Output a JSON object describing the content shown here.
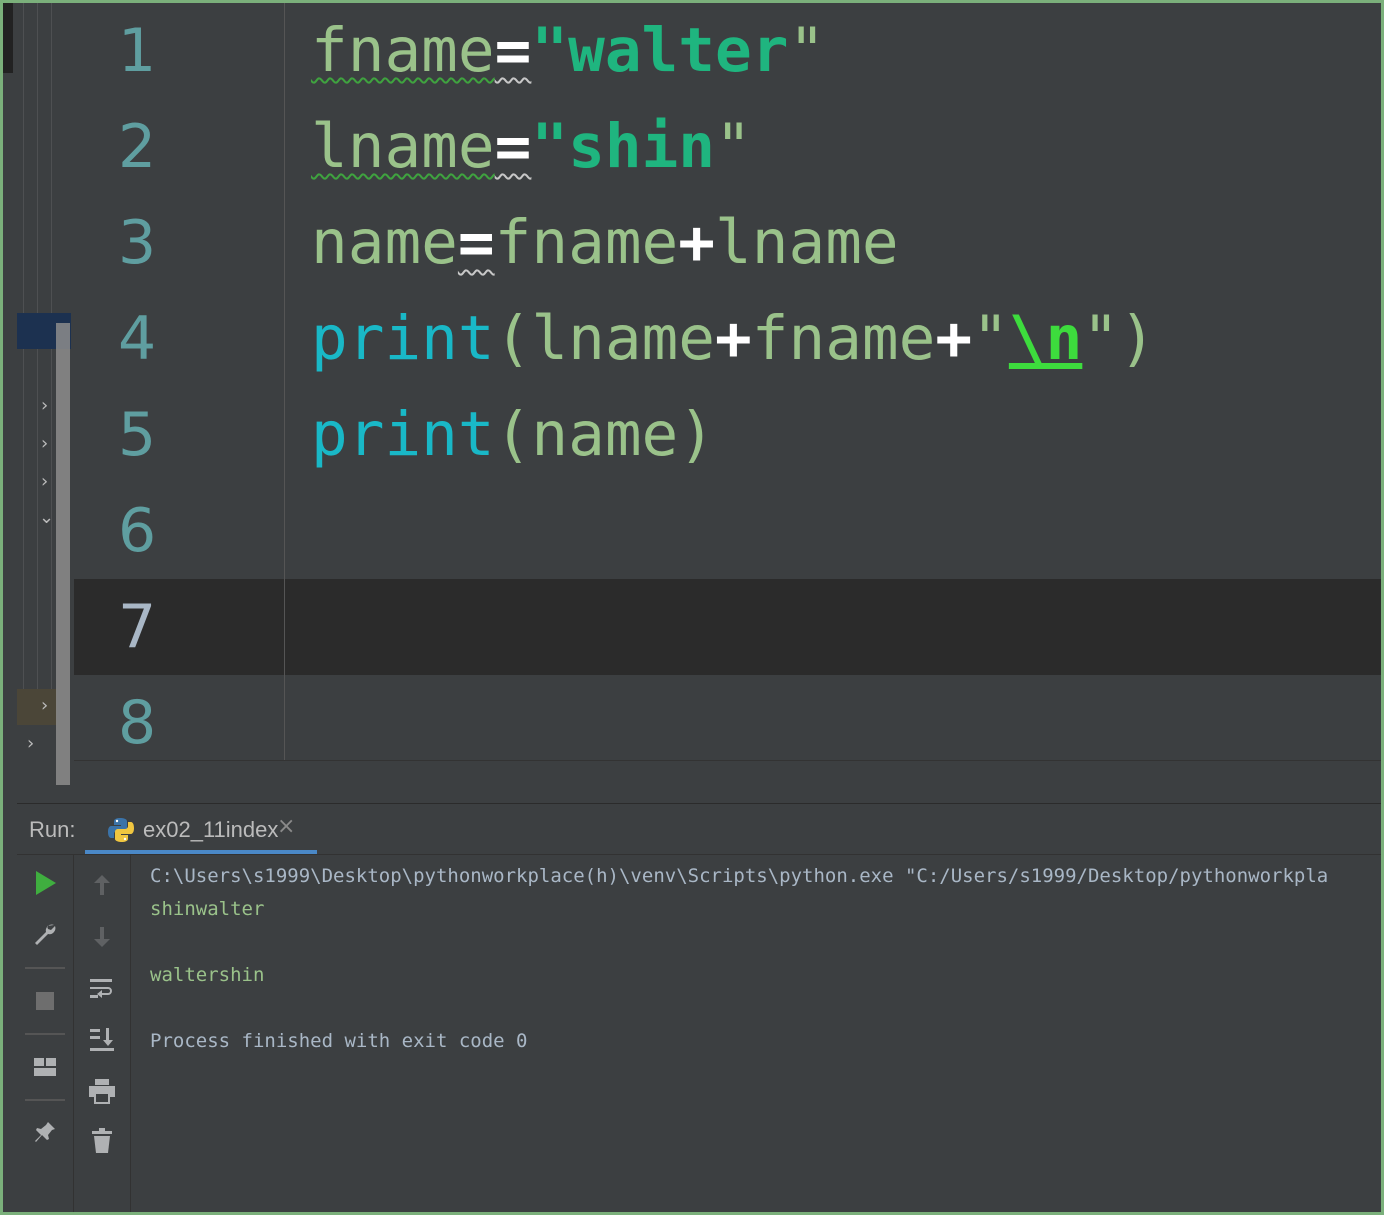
{
  "editor": {
    "line_numbers": [
      "1",
      "2",
      "3",
      "4",
      "5",
      "6",
      "7",
      "8"
    ],
    "lines": {
      "l1": {
        "var": "fname",
        "op": "=",
        "q1": "\"",
        "str": "walter",
        "q2": "\""
      },
      "l2": {
        "var": "lname",
        "op": "=",
        "q1": "\"",
        "str": "shin",
        "q2": "\""
      },
      "l3": {
        "var": "name",
        "op": "=",
        "a": "fname",
        "plus": "+",
        "b": "lname"
      },
      "l4": {
        "fn": "print",
        "open": "(",
        "a": "lname",
        "plus1": "+",
        "b": "fname",
        "plus2": "+",
        "q1": "\"",
        "esc": "\\n",
        "q2": "\"",
        "close": ")"
      },
      "l5": {
        "fn": "print",
        "open": "(",
        "arg": "name",
        "close": ")"
      }
    },
    "current_line": "7"
  },
  "run_panel": {
    "label": "Run:",
    "tab_label": "ex02_11index",
    "tab_close": "×",
    "console_lines": [
      "C:\\Users\\s1999\\Desktop\\pythonworkplace(h)\\venv\\Scripts\\python.exe \"C:/Users/s1999/Desktop/pythonworkpla",
      "shinwalter",
      "",
      "waltershin",
      "",
      "Process finished with exit code 0"
    ]
  },
  "icons": {
    "run": "play-icon",
    "wrench": "wrench-icon",
    "stop": "stop-icon",
    "layout": "layout-icon",
    "pin": "pin-icon",
    "up": "arrow-up-icon",
    "down": "arrow-down-icon",
    "wrap": "soft-wrap-icon",
    "scroll_end": "scroll-to-end-icon",
    "print": "print-icon",
    "trash": "trash-icon"
  },
  "colors": {
    "accent": "#4a88c7",
    "frame": "#7bb07b",
    "run_green": "#3fae3f"
  }
}
